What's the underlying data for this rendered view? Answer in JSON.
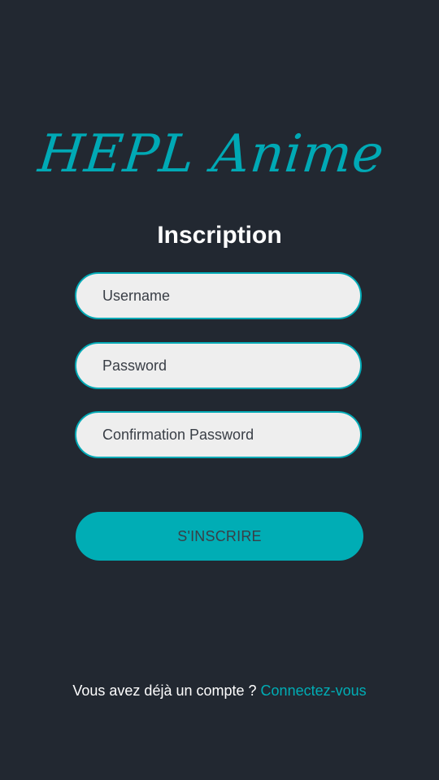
{
  "logo": {
    "text": "HEPL Anime"
  },
  "form": {
    "title": "Inscription",
    "username_placeholder": "Username",
    "password_placeholder": "Password",
    "confirm_placeholder": "Confirmation Password",
    "submit_label": "S'INSCRIRE"
  },
  "footer": {
    "prompt": "Vous avez déjà un compte ?",
    "link_label": "Connectez-vous"
  },
  "colors": {
    "background": "#222831",
    "accent": "#00adb5",
    "field_bg": "#eeeeee",
    "dark_text": "#393e46"
  }
}
